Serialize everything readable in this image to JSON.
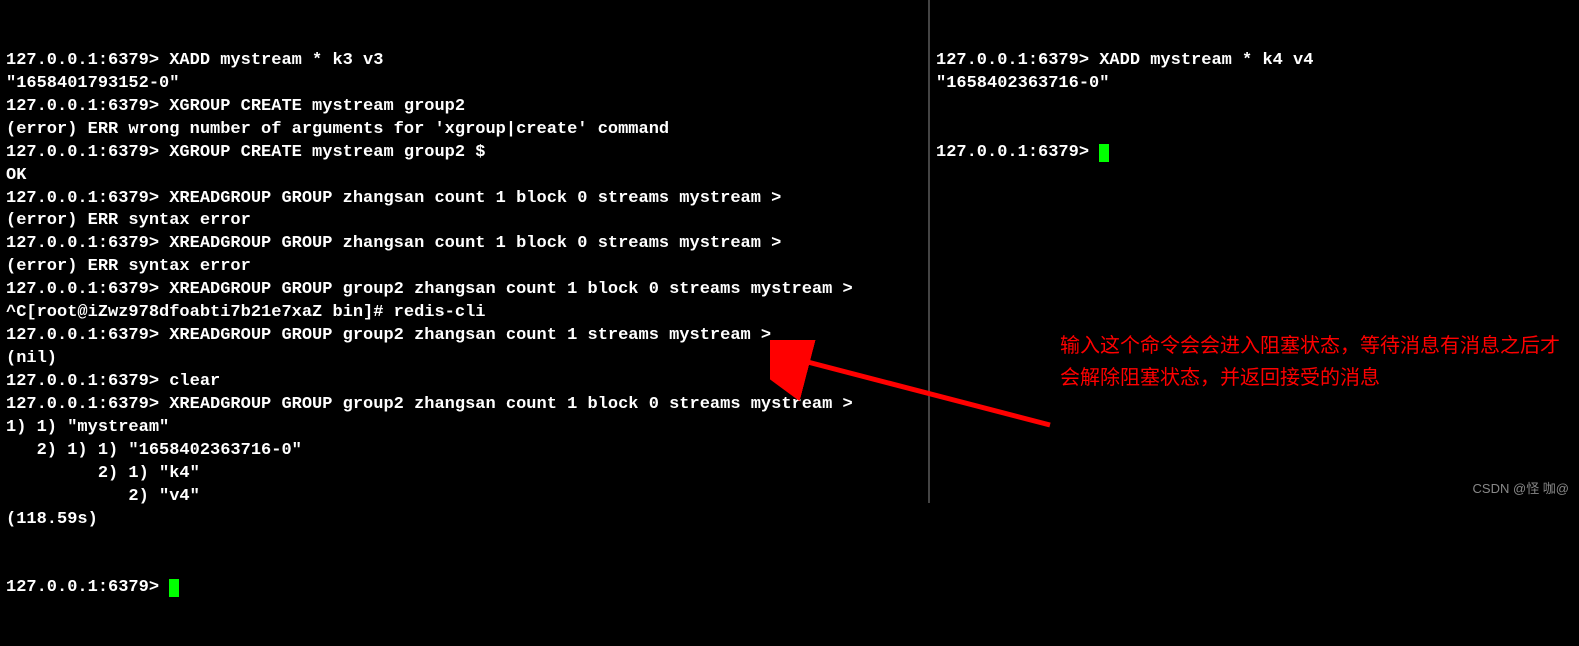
{
  "left_terminal": {
    "lines": [
      "127.0.0.1:6379> XADD mystream * k3 v3",
      "\"1658401793152-0\"",
      "127.0.0.1:6379> XGROUP CREATE mystream group2",
      "(error) ERR wrong number of arguments for 'xgroup|create' command",
      "127.0.0.1:6379> XGROUP CREATE mystream group2 $",
      "OK",
      "127.0.0.1:6379> XREADGROUP GROUP zhangsan count 1 block 0 streams mystream >",
      "(error) ERR syntax error",
      "127.0.0.1:6379> XREADGROUP GROUP zhangsan count 1 block 0 streams mystream >",
      "(error) ERR syntax error",
      "127.0.0.1:6379> XREADGROUP GROUP group2 zhangsan count 1 block 0 streams mystream >",
      "^C[root@iZwz978dfoabti7b21e7xaZ bin]# redis-cli",
      "127.0.0.1:6379> XREADGROUP GROUP group2 zhangsan count 1 streams mystream >",
      "(nil)",
      "127.0.0.1:6379> clear",
      "127.0.0.1:6379> XREADGROUP GROUP group2 zhangsan count 1 block 0 streams mystream >",
      "1) 1) \"mystream\"",
      "   2) 1) 1) \"1658402363716-0\"",
      "         2) 1) \"k4\"",
      "            2) \"v4\"",
      "(118.59s)"
    ],
    "final_prompt": "127.0.0.1:6379> "
  },
  "right_terminal": {
    "lines": [
      "127.0.0.1:6379> XADD mystream * k4 v4",
      "\"1658402363716-0\""
    ],
    "final_prompt": "127.0.0.1:6379> "
  },
  "annotation": {
    "text": "输入这个命令会会进入阻塞状态，等待消息有消息之后才会解除阻塞状态，并返回接受的消息"
  },
  "watermark": "CSDN @怪 咖@"
}
